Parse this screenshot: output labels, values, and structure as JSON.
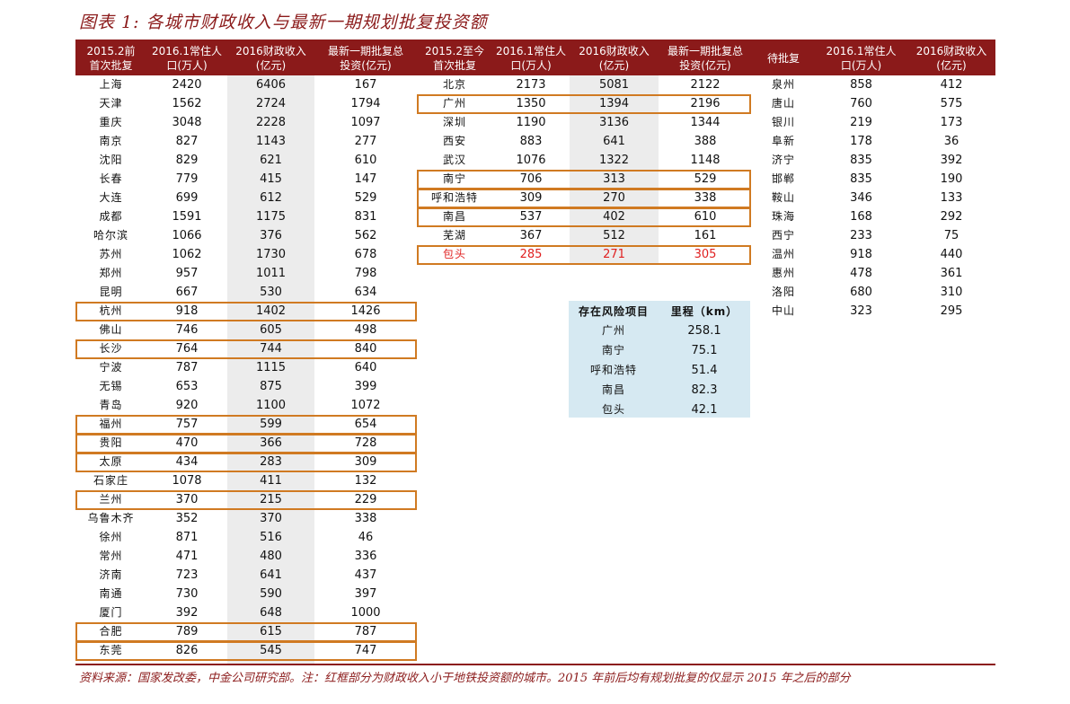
{
  "title": "图表 1: 各城市财政收入与最新一期规划批复投资额",
  "headers": [
    "2015.2前\n首次批复",
    "2016.1常住人\n口(万人)",
    "2016财政收入\n(亿元)",
    "最新一期批复总\n投资(亿元)",
    "2015.2至今\n首次批复",
    "2016.1常住人\n口(万人)",
    "2016财政收入\n(亿元)",
    "最新一期批复总\n投资(亿元)",
    "待批复",
    "2016.1常住人\n口(万人)",
    "2016财政收入\n(亿元)"
  ],
  "group1": [
    {
      "city": "上海",
      "pop": "2420",
      "rev": "6406",
      "inv": "167"
    },
    {
      "city": "天津",
      "pop": "1562",
      "rev": "2724",
      "inv": "1794"
    },
    {
      "city": "重庆",
      "pop": "3048",
      "rev": "2228",
      "inv": "1097"
    },
    {
      "city": "南京",
      "pop": "827",
      "rev": "1143",
      "inv": "277"
    },
    {
      "city": "沈阳",
      "pop": "829",
      "rev": "621",
      "inv": "610"
    },
    {
      "city": "长春",
      "pop": "779",
      "rev": "415",
      "inv": "147"
    },
    {
      "city": "大连",
      "pop": "699",
      "rev": "612",
      "inv": "529"
    },
    {
      "city": "成都",
      "pop": "1591",
      "rev": "1175",
      "inv": "831"
    },
    {
      "city": "哈尔滨",
      "pop": "1066",
      "rev": "376",
      "inv": "562"
    },
    {
      "city": "苏州",
      "pop": "1062",
      "rev": "1730",
      "inv": "678"
    },
    {
      "city": "郑州",
      "pop": "957",
      "rev": "1011",
      "inv": "798"
    },
    {
      "city": "昆明",
      "pop": "667",
      "rev": "530",
      "inv": "634"
    },
    {
      "city": "杭州",
      "pop": "918",
      "rev": "1402",
      "inv": "1426"
    },
    {
      "city": "佛山",
      "pop": "746",
      "rev": "605",
      "inv": "498"
    },
    {
      "city": "长沙",
      "pop": "764",
      "rev": "744",
      "inv": "840"
    },
    {
      "city": "宁波",
      "pop": "787",
      "rev": "1115",
      "inv": "640"
    },
    {
      "city": "无锡",
      "pop": "653",
      "rev": "875",
      "inv": "399"
    },
    {
      "city": "青岛",
      "pop": "920",
      "rev": "1100",
      "inv": "1072"
    },
    {
      "city": "福州",
      "pop": "757",
      "rev": "599",
      "inv": "654"
    },
    {
      "city": "贵阳",
      "pop": "470",
      "rev": "366",
      "inv": "728"
    },
    {
      "city": "太原",
      "pop": "434",
      "rev": "283",
      "inv": "309"
    },
    {
      "city": "石家庄",
      "pop": "1078",
      "rev": "411",
      "inv": "132"
    },
    {
      "city": "兰州",
      "pop": "370",
      "rev": "215",
      "inv": "229"
    },
    {
      "city": "乌鲁木齐",
      "pop": "352",
      "rev": "370",
      "inv": "338"
    },
    {
      "city": "徐州",
      "pop": "871",
      "rev": "516",
      "inv": "46"
    },
    {
      "city": "常州",
      "pop": "471",
      "rev": "480",
      "inv": "336"
    },
    {
      "city": "济南",
      "pop": "723",
      "rev": "641",
      "inv": "437"
    },
    {
      "city": "南通",
      "pop": "730",
      "rev": "590",
      "inv": "397"
    },
    {
      "city": "厦门",
      "pop": "392",
      "rev": "648",
      "inv": "1000"
    },
    {
      "city": "合肥",
      "pop": "789",
      "rev": "615",
      "inv": "787"
    },
    {
      "city": "东莞",
      "pop": "826",
      "rev": "545",
      "inv": "747"
    }
  ],
  "group2": [
    {
      "city": "北京",
      "pop": "2173",
      "rev": "5081",
      "inv": "2122"
    },
    {
      "city": "广州",
      "pop": "1350",
      "rev": "1394",
      "inv": "2196"
    },
    {
      "city": "深圳",
      "pop": "1190",
      "rev": "3136",
      "inv": "1344"
    },
    {
      "city": "西安",
      "pop": "883",
      "rev": "641",
      "inv": "388"
    },
    {
      "city": "武汉",
      "pop": "1076",
      "rev": "1322",
      "inv": "1148"
    },
    {
      "city": "南宁",
      "pop": "706",
      "rev": "313",
      "inv": "529"
    },
    {
      "city": "呼和浩特",
      "pop": "309",
      "rev": "270",
      "inv": "338"
    },
    {
      "city": "南昌",
      "pop": "537",
      "rev": "402",
      "inv": "610"
    },
    {
      "city": "芜湖",
      "pop": "367",
      "rev": "512",
      "inv": "161"
    },
    {
      "city": "包头",
      "pop": "285",
      "rev": "271",
      "inv": "305"
    }
  ],
  "group3": [
    {
      "city": "泉州",
      "pop": "858",
      "rev": "412"
    },
    {
      "city": "唐山",
      "pop": "760",
      "rev": "575"
    },
    {
      "city": "银川",
      "pop": "219",
      "rev": "173"
    },
    {
      "city": "阜新",
      "pop": "178",
      "rev": "36"
    },
    {
      "city": "济宁",
      "pop": "835",
      "rev": "392"
    },
    {
      "city": "邯郸",
      "pop": "835",
      "rev": "190"
    },
    {
      "city": "鞍山",
      "pop": "346",
      "rev": "133"
    },
    {
      "city": "珠海",
      "pop": "168",
      "rev": "292"
    },
    {
      "city": "西宁",
      "pop": "233",
      "rev": "75"
    },
    {
      "city": "温州",
      "pop": "918",
      "rev": "440"
    },
    {
      "city": "惠州",
      "pop": "478",
      "rev": "361"
    },
    {
      "city": "洛阳",
      "pop": "680",
      "rev": "310"
    },
    {
      "city": "中山",
      "pop": "323",
      "rev": "295"
    }
  ],
  "risk_table": {
    "headers": [
      "存在风险项目",
      "里程（km）"
    ],
    "rows": [
      {
        "name": "广州",
        "km": "258.1"
      },
      {
        "name": "南宁",
        "km": "75.1"
      },
      {
        "name": "呼和浩特",
        "km": "51.4"
      },
      {
        "name": "南昌",
        "km": "82.3"
      },
      {
        "name": "包头",
        "km": "42.1"
      }
    ]
  },
  "highlight_color": "#d07a22",
  "header_color": "#8b1a1a",
  "red_color": "#e02020",
  "footnote": "资料来源：国家发改委，中金公司研究部。注：红框部分为财政收入小于地铁投资额的城市。2015 年前后均有规划批复的仅显示 2015 年之后的部分"
}
